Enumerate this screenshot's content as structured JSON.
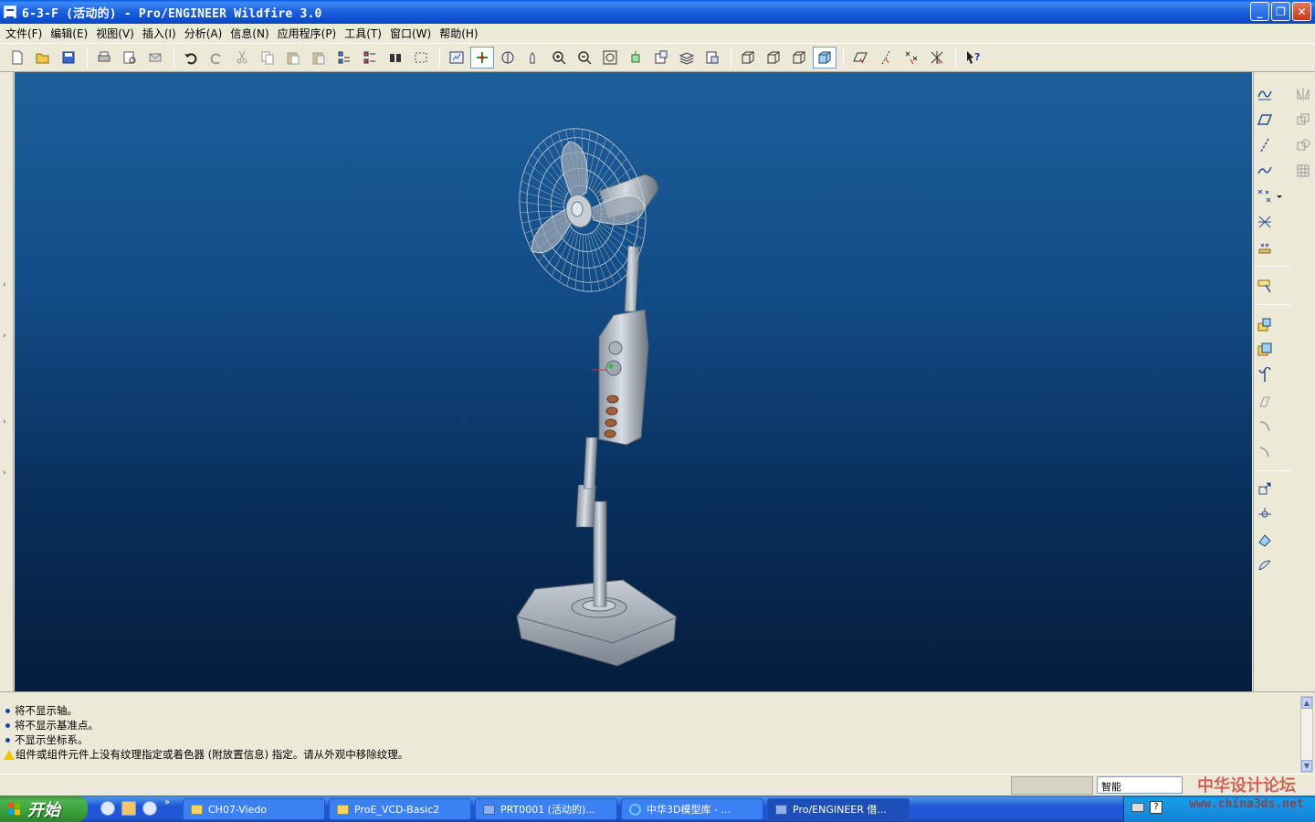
{
  "window": {
    "title": "6-3-F (活动的) - Pro/ENGINEER Wildfire 3.0",
    "controls": {
      "minimize": "_",
      "maximize": "❐",
      "close": "✕"
    }
  },
  "menu": {
    "items": [
      "文件(F)",
      "编辑(E)",
      "视图(V)",
      "插入(I)",
      "分析(A)",
      "信息(N)",
      "应用程序(P)",
      "工具(T)",
      "窗口(W)",
      "帮助(H)"
    ]
  },
  "toolbar": {
    "icons": [
      "new-icon",
      "open-icon",
      "save-icon",
      "print-icon",
      "print-preview-icon",
      "email-icon",
      "undo-icon",
      "redo-icon",
      "cut-icon",
      "copy-icon",
      "paste-icon",
      "paste-special-icon",
      "regenerate-icon",
      "regen-manager-icon",
      "find-icon",
      "select-box-icon",
      "repaint-icon",
      "spin-center-icon",
      "orient-mode-icon",
      "pan-icon",
      "zoom-in-icon",
      "zoom-out-icon",
      "refit-icon",
      "reorient-icon",
      "saved-views-icon",
      "layers-icon",
      "view-manager-icon",
      "wireframe-icon",
      "hidden-line-icon",
      "no-hidden-icon",
      "shading-icon",
      "datum-planes-icon",
      "datum-axes-icon",
      "datum-points-icon",
      "coord-systems-icon",
      "context-help-icon"
    ]
  },
  "right_toolbar": {
    "icons": [
      "sketch-icon",
      "datum-plane-icon",
      "datum-axis-icon",
      "datum-curve-icon",
      "datum-point-icon",
      "coord-sys-icon",
      "analysis-icon",
      "sketch-tool-icon",
      "extrude-icon",
      "revolve-icon",
      "sweep-icon",
      "blend-icon",
      "hole-icon",
      "round-icon",
      "chamfer-icon",
      "rib-icon",
      "shell-icon",
      "draft-icon",
      "pattern-icon",
      "mirror-icon",
      "merge-icon",
      "trim-icon",
      "extend-icon"
    ]
  },
  "messages": [
    {
      "type": "info",
      "text": "将不显示轴。"
    },
    {
      "type": "info",
      "text": "将不显示基准点。"
    },
    {
      "type": "info",
      "text": "不显示坐标系。"
    },
    {
      "type": "warning",
      "text": "组件或组件元件上没有纹理指定或着色器 (附放置信息) 指定。请从外观中移除纹理。"
    }
  ],
  "status": {
    "filter_value": "智能"
  },
  "taskbar": {
    "start_label": "开始",
    "buttons": [
      {
        "label": "CH07-Viedo",
        "icon": "folder-icon"
      },
      {
        "label": "ProE_VCD-Basic2",
        "icon": "folder-icon"
      },
      {
        "label": "PRT0001 (活动的)...",
        "icon": "proe-window-icon"
      },
      {
        "label": "中华3D模型库 - ...",
        "icon": "ie-icon"
      },
      {
        "label": "Pro/ENGINEER 借...",
        "icon": "proe-window-icon"
      }
    ]
  },
  "watermark": {
    "text": "中华设计论坛",
    "url": "www.china3ds.net"
  },
  "colors": {
    "viewport_top": "#1d5f9c",
    "viewport_bottom": "#061d3c",
    "titlebar": "#0d4fd1",
    "chrome": "#ece9d8"
  }
}
